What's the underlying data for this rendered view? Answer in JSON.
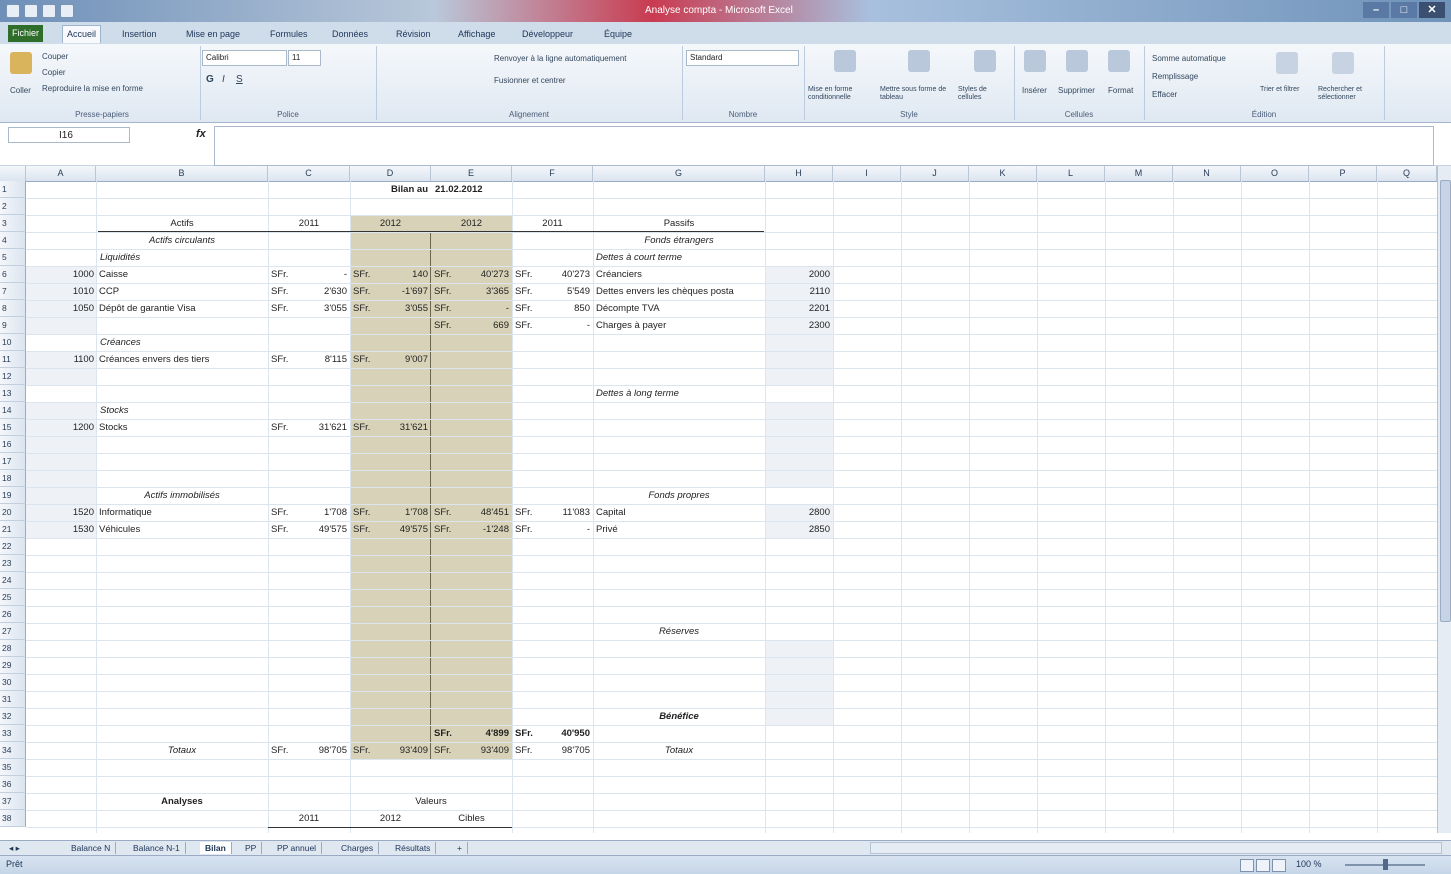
{
  "window": {
    "title": "Analyse compta - Microsoft Excel",
    "controls": [
      "–",
      "□",
      "✕"
    ]
  },
  "ribbon_tabs": [
    "Fichier",
    "Accueil",
    "Insertion",
    "Mise en page",
    "Formules",
    "Données",
    "Révision",
    "Affichage",
    "Développeur",
    "Équipe"
  ],
  "ribbon": {
    "clipboard": {
      "paste": "Coller",
      "cut": "Couper",
      "copy": "Copier",
      "format_painter": "Reproduire la mise en forme",
      "label": "Presse-papiers"
    },
    "font": {
      "name": "Calibri",
      "size": "11",
      "label": "Police",
      "bold": "G",
      "italic": "I",
      "underline": "S"
    },
    "alignment": {
      "wrap": "Renvoyer à la ligne automatiquement",
      "merge": "Fusionner et centrer",
      "label": "Alignement"
    },
    "number": {
      "format": "Standard",
      "label": "Nombre"
    },
    "styles": {
      "conditional": "Mise en forme conditionnelle",
      "table": "Mettre sous forme de tableau",
      "cell_styles": "Styles de cellules",
      "label": "Style"
    },
    "cells": {
      "insert": "Insérer",
      "delete": "Supprimer",
      "format": "Format",
      "label": "Cellules"
    },
    "editing": {
      "autosum": "Somme automatique",
      "fill": "Remplissage",
      "clear": "Effacer",
      "sort": "Trier et filtrer",
      "find": "Rechercher et sélectionner",
      "label": "Édition"
    }
  },
  "formula_bar": {
    "name_box": "I16",
    "fx": "fx",
    "value": ""
  },
  "columns": [
    "A",
    "B",
    "C",
    "D",
    "E",
    "F",
    "G",
    "H",
    "I",
    "J",
    "K",
    "L",
    "M",
    "N",
    "O",
    "P",
    "Q"
  ],
  "rows": [
    "1",
    "2",
    "3",
    "4",
    "5",
    "6",
    "7",
    "8",
    "9",
    "10",
    "11",
    "12",
    "13",
    "14",
    "15",
    "16",
    "17",
    "18",
    "19",
    "20",
    "21",
    "22",
    "23",
    "24",
    "25",
    "26",
    "27",
    "28",
    "29",
    "30",
    "31",
    "32",
    "33",
    "34",
    "35",
    "36",
    "37",
    "38"
  ],
  "cells": {
    "d1": "Bilan au",
    "e1": "21.02.2012",
    "b3": "Actifs",
    "c3": "2011",
    "d3": "2012",
    "e3": "2012",
    "f3": "2011",
    "g3": "Passifs",
    "b4": "Actifs circulants",
    "g4": "Fonds étrangers",
    "b5": "Liquidités",
    "g5": "Dettes à court terme",
    "a6": "1000",
    "b6": "Caisse",
    "c6a": "SFr.",
    "c6": "-",
    "d6a": "SFr.",
    "d6": "140",
    "e6a": "SFr.",
    "e6": "40'273",
    "f6a": "SFr.",
    "f6": "40'273",
    "g6": "Créanciers",
    "h6": "2000",
    "a7": "1010",
    "b7": "CCP",
    "c7a": "SFr.",
    "c7": "2'630",
    "d7a": "SFr.",
    "d7": "-1'697",
    "e7a": "SFr.",
    "e7": "3'365",
    "f7a": "SFr.",
    "f7": "5'549",
    "g7": "Dettes envers les chèques posta",
    "h7": "2110",
    "a8": "1050",
    "b8": "Dépôt de garantie Visa",
    "c8a": "SFr.",
    "c8": "3'055",
    "d8a": "SFr.",
    "d8": "3'055",
    "e8a": "SFr.",
    "e8": "-",
    "f8a": "SFr.",
    "f8": "850",
    "g8": "Décompte TVA",
    "h8": "2201",
    "e9a": "SFr.",
    "e9": "669",
    "f9a": "SFr.",
    "f9": "-",
    "g9": "Charges à payer",
    "h9": "2300",
    "b10": "Créances",
    "a11": "1100",
    "b11": "Créances envers des tiers",
    "c11a": "SFr.",
    "c11": "8'115",
    "d11a": "SFr.",
    "d11": "9'007",
    "g13": "Dettes à long terme",
    "b14": "Stocks",
    "a15": "1200",
    "b15": "Stocks",
    "c15a": "SFr.",
    "c15": "31'621",
    "d15a": "SFr.",
    "d15": "31'621",
    "b19": "Actifs immobilisés",
    "g19": "Fonds propres",
    "a20": "1520",
    "b20": "Informatique",
    "c20a": "SFr.",
    "c20": "1'708",
    "d20a": "SFr.",
    "d20": "1'708",
    "e20a": "SFr.",
    "e20": "48'451",
    "f20a": "SFr.",
    "f20": "11'083",
    "g20": "Capital",
    "h20": "2800",
    "a21": "1530",
    "b21": "Véhicules",
    "c21a": "SFr.",
    "c21": "49'575",
    "d21a": "SFr.",
    "d21": "49'575",
    "e21a": "SFr.",
    "e21": "-1'248",
    "f21a": "SFr.",
    "f21": "-",
    "g21": "Privé",
    "h21": "2850",
    "g27": "Réserves",
    "g32": "Bénéfice",
    "e33a": "SFr.",
    "e33": "4'899",
    "f33a": "SFr.",
    "f33": "40'950",
    "b34": "Totaux",
    "c34a": "SFr.",
    "c34": "98'705",
    "d34a": "SFr.",
    "d34": "93'409",
    "e34a": "SFr.",
    "e34": "93'409",
    "f34a": "SFr.",
    "f34": "98'705",
    "g34": "Totaux",
    "b37": "Analyses",
    "d37": "Valeurs",
    "c38": "2011",
    "d38": "2012",
    "e38": "Cibles"
  },
  "sheet_tabs": [
    "Balance N",
    "Balance N-1",
    "Bilan",
    "PP",
    "PP annuel",
    "Charges",
    "Résultats"
  ],
  "active_sheet": "Bilan",
  "status": {
    "ready": "Prêt",
    "zoom": "100 %"
  },
  "colors": {
    "shaded_columns": "#d8d3b8",
    "shaded_header": "#cbc6a8",
    "light_band": "#eef1f5"
  }
}
